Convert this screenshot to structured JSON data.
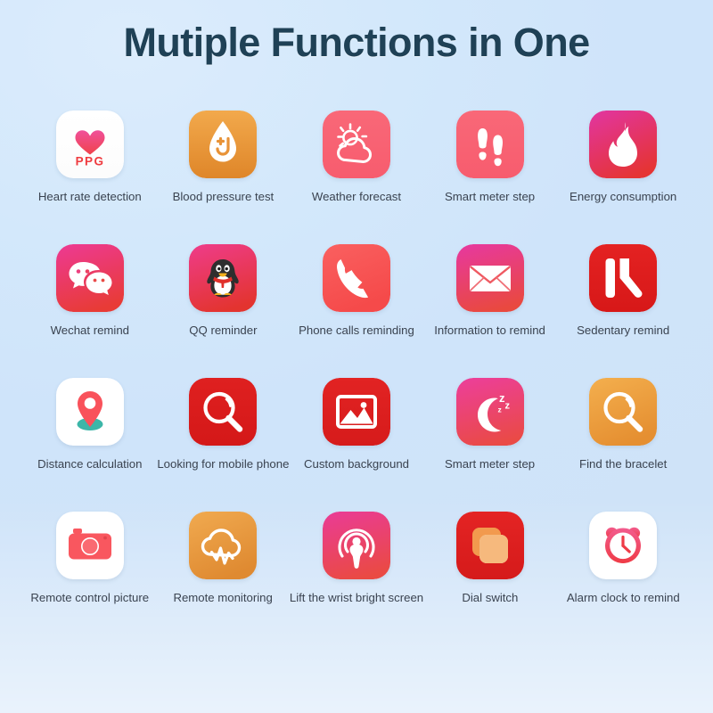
{
  "page": {
    "title": "Mutiple Functions in One",
    "background_top": "#d9ecfd",
    "background_bottom": "#e7f3fd",
    "title_color": "#1f4156",
    "label_color": "#3a4350"
  },
  "grid": {
    "rows": 4,
    "columns": 5,
    "items": [
      {
        "label": "Heart rate detection",
        "icon": "heart-ppg-icon",
        "tile_colors": [
          "#ffffff",
          "#fdfdfd"
        ],
        "icon_colors": [
          "#f0509a",
          "#f0434b"
        ],
        "badge_text": "PPG",
        "badge_color": "#ef3b3f"
      },
      {
        "label": "Blood pressure test",
        "icon": "blood-drop-icon",
        "tile_colors": [
          "#f0a041",
          "#e08a2e"
        ],
        "icon_colors": [
          "#ffffff",
          "#ffffff"
        ]
      },
      {
        "label": "Weather forecast",
        "icon": "sun-cloud-icon",
        "tile_colors": [
          "#f96576",
          "#f75f70"
        ],
        "icon_colors": [
          "#ffffff",
          "#ffffff"
        ]
      },
      {
        "label": "Smart meter step",
        "icon": "footsteps-icon",
        "tile_colors": [
          "#f96576",
          "#f75f70"
        ],
        "icon_colors": [
          "#ffffff",
          "#ffffff"
        ]
      },
      {
        "label": "Energy consumption",
        "icon": "flame-icon",
        "tile_colors": [
          "#e2359c",
          "#e53434"
        ],
        "icon_colors": [
          "#ffffff",
          "#ffffff"
        ]
      },
      {
        "label": "Wechat remind",
        "icon": "wechat-bubbles-icon",
        "tile_colors": [
          "#ed3a8f",
          "#e83b36"
        ],
        "icon_colors": [
          "#ffffff",
          "#ffffff"
        ]
      },
      {
        "label": "QQ reminder",
        "icon": "qq-penguin-icon",
        "tile_colors": [
          "#ee3c86",
          "#e3342f"
        ],
        "icon_colors": [
          "#2b2b2b",
          "#ffffff"
        ]
      },
      {
        "label": "Phone calls reminding",
        "icon": "phone-handset-icon",
        "tile_colors": [
          "#f95b5b",
          "#f64a4a"
        ],
        "icon_colors": [
          "#ffffff",
          "#ffffff"
        ]
      },
      {
        "label": "Information to remind",
        "icon": "envelope-icon",
        "tile_colors": [
          "#e7399b",
          "#e9493f"
        ],
        "icon_colors": [
          "#ffffff",
          "#ffffff"
        ]
      },
      {
        "label": "Sedentary remind",
        "icon": "sedentary-legs-icon",
        "tile_colors": [
          "#e21f1f",
          "#d91a18"
        ],
        "icon_colors": [
          "#ffffff",
          "#ffffff"
        ]
      },
      {
        "label": "Distance calculation",
        "icon": "map-pin-icon",
        "tile_colors": [
          "#ffffff",
          "#fdfdfd"
        ],
        "icon_colors": [
          "#f9525b",
          "#3cb6a8"
        ]
      },
      {
        "label": "Looking for mobile phone",
        "icon": "magnifier-red-icon",
        "tile_colors": [
          "#dd1d1d",
          "#d61a1a"
        ],
        "icon_colors": [
          "#ffffff",
          "#ffffff"
        ]
      },
      {
        "label": "Custom background",
        "icon": "picture-frame-icon",
        "tile_colors": [
          "#e02121",
          "#d81d1d"
        ],
        "icon_colors": [
          "#ffffff",
          "#ffffff"
        ]
      },
      {
        "label": "Smart meter step",
        "icon": "moon-sleep-icon",
        "tile_colors": [
          "#ec3f97",
          "#ea4a46"
        ],
        "icon_colors": [
          "#ffffff",
          "#ffffff"
        ]
      },
      {
        "label": "Find the bracelet",
        "icon": "magnifier-orange-icon",
        "tile_colors": [
          "#f2a846",
          "#e69334"
        ],
        "icon_colors": [
          "#ffffff",
          "#ffffff"
        ]
      },
      {
        "label": "Remote control picture",
        "icon": "camera-icon",
        "tile_colors": [
          "#ffffff",
          "#fdfdfd"
        ],
        "icon_colors": [
          "#f9575f",
          "#f9575f"
        ]
      },
      {
        "label": "Remote monitoring",
        "icon": "cloud-pulse-icon",
        "tile_colors": [
          "#efa34a",
          "#e08c33"
        ],
        "icon_colors": [
          "#ffffff",
          "#ffffff"
        ]
      },
      {
        "label": "Lift the wrist bright screen",
        "icon": "wrist-broadcast-icon",
        "tile_colors": [
          "#ea3c92",
          "#ea4a43"
        ],
        "icon_colors": [
          "#ffffff",
          "#ffffff"
        ]
      },
      {
        "label": "Dial switch",
        "icon": "dial-squares-icon",
        "tile_colors": [
          "#e22020",
          "#d51a1a"
        ],
        "icon_colors": [
          "#f29a4e",
          "#ffffff"
        ]
      },
      {
        "label": "Alarm clock to remind",
        "icon": "alarm-clock-icon",
        "tile_colors": [
          "#ffffff",
          "#fdfdfd"
        ],
        "icon_colors": [
          "#f25c8e",
          "#ef3b46"
        ]
      }
    ]
  }
}
